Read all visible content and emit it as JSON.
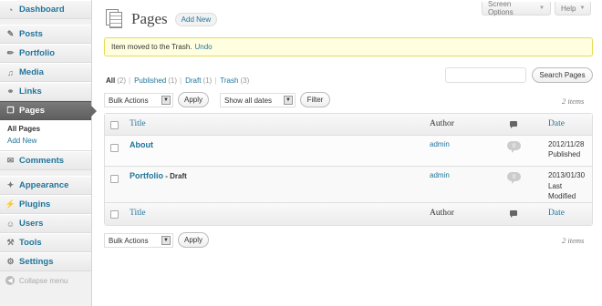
{
  "sidebar": {
    "items": [
      {
        "label": "Dashboard",
        "icon": "dashboard-icon"
      },
      {
        "label": "Posts",
        "icon": "pin-icon"
      },
      {
        "label": "Portfolio",
        "icon": "pencil-icon"
      },
      {
        "label": "Media",
        "icon": "media-icon"
      },
      {
        "label": "Links",
        "icon": "link-icon"
      },
      {
        "label": "Pages",
        "icon": "pages-icon"
      },
      {
        "label": "Comments",
        "icon": "comment-icon"
      },
      {
        "label": "Appearance",
        "icon": "appearance-icon"
      },
      {
        "label": "Plugins",
        "icon": "plug-icon"
      },
      {
        "label": "Users",
        "icon": "users-icon"
      },
      {
        "label": "Tools",
        "icon": "tools-icon"
      },
      {
        "label": "Settings",
        "icon": "settings-icon"
      }
    ],
    "submenu": {
      "all_pages": "All Pages",
      "add_new": "Add New"
    },
    "collapse": "Collapse menu"
  },
  "header": {
    "title": "Pages",
    "add_new": "Add New",
    "screen_options": "Screen Options",
    "help": "Help"
  },
  "notice": {
    "text": "Item moved to the Trash.",
    "undo": "Undo"
  },
  "filters": {
    "views": [
      {
        "label": "All",
        "count": "(2)"
      },
      {
        "label": "Published",
        "count": "(1)"
      },
      {
        "label": "Draft",
        "count": "(1)"
      },
      {
        "label": "Trash",
        "count": "(3)"
      }
    ],
    "separator": "|"
  },
  "search": {
    "button": "Search Pages",
    "value": ""
  },
  "tablenav": {
    "bulk_actions": "Bulk Actions",
    "apply": "Apply",
    "dates": "Show all dates",
    "filter": "Filter",
    "items_count": "2 items"
  },
  "table": {
    "columns": {
      "title": "Title",
      "author": "Author",
      "date": "Date"
    },
    "rows": [
      {
        "title": "About",
        "state": "",
        "author": "admin",
        "comments": "0",
        "date": "2012/11/28",
        "status": "Published"
      },
      {
        "title": "Portfolio",
        "state": "- Draft",
        "author": "admin",
        "comments": "0",
        "date": "2013/01/30",
        "status": "Last Modified"
      }
    ]
  },
  "colors": {
    "accent": "#21759b",
    "notice_bg": "#ffffe0",
    "notice_border": "#e6db55",
    "active_menu": "#6a6a6a"
  }
}
